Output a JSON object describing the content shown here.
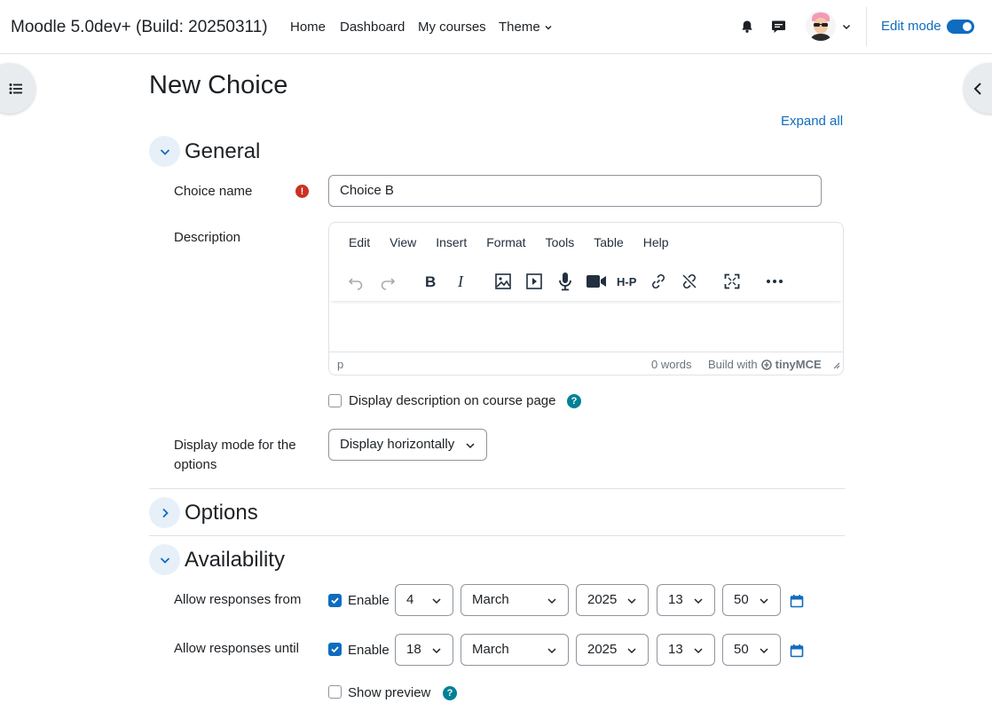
{
  "navbar": {
    "brand": "Moodle 5.0dev+ (Build: 20250311)",
    "links": [
      "Home",
      "Dashboard",
      "My courses"
    ],
    "theme_label": "Theme",
    "edit_mode_label": "Edit mode",
    "edit_mode_on": true
  },
  "page": {
    "title": "New Choice",
    "expand_all": "Expand all"
  },
  "general": {
    "heading": "General",
    "choice_name_label": "Choice name",
    "choice_name_value": "Choice B",
    "description_label": "Description",
    "editor": {
      "menu": [
        "Edit",
        "View",
        "Insert",
        "Format",
        "Tools",
        "Table",
        "Help"
      ],
      "toolbar_icons": [
        "undo-icon",
        "redo-icon",
        "bold-icon",
        "italic-icon",
        "image-icon",
        "media-icon",
        "microphone-icon",
        "video-camera-icon",
        "h5p-icon",
        "link-icon",
        "unlink-icon",
        "fullscreen-icon",
        "more-icon"
      ],
      "status_path": "p",
      "word_count": "0 words",
      "build_with": "Build with",
      "brand": "tinyMCE"
    },
    "display_description_label": "Display description on course page",
    "display_description_checked": false,
    "display_mode_label_line1": "Display mode for the",
    "display_mode_label_line2": "options",
    "display_mode_value": "Display horizontally"
  },
  "options": {
    "heading": "Options"
  },
  "availability": {
    "heading": "Availability",
    "from": {
      "label": "Allow responses from",
      "enable_label": "Enable",
      "enabled": true,
      "day": "4",
      "month": "March",
      "year": "2025",
      "hour": "13",
      "minute": "50"
    },
    "until": {
      "label": "Allow responses until",
      "enable_label": "Enable",
      "enabled": true,
      "day": "18",
      "month": "March",
      "year": "2025",
      "hour": "13",
      "minute": "50"
    },
    "show_preview_label": "Show preview",
    "show_preview_checked": false
  },
  "colors": {
    "accent": "#0f6cbf",
    "required": "#ca3120",
    "help": "#008196"
  }
}
